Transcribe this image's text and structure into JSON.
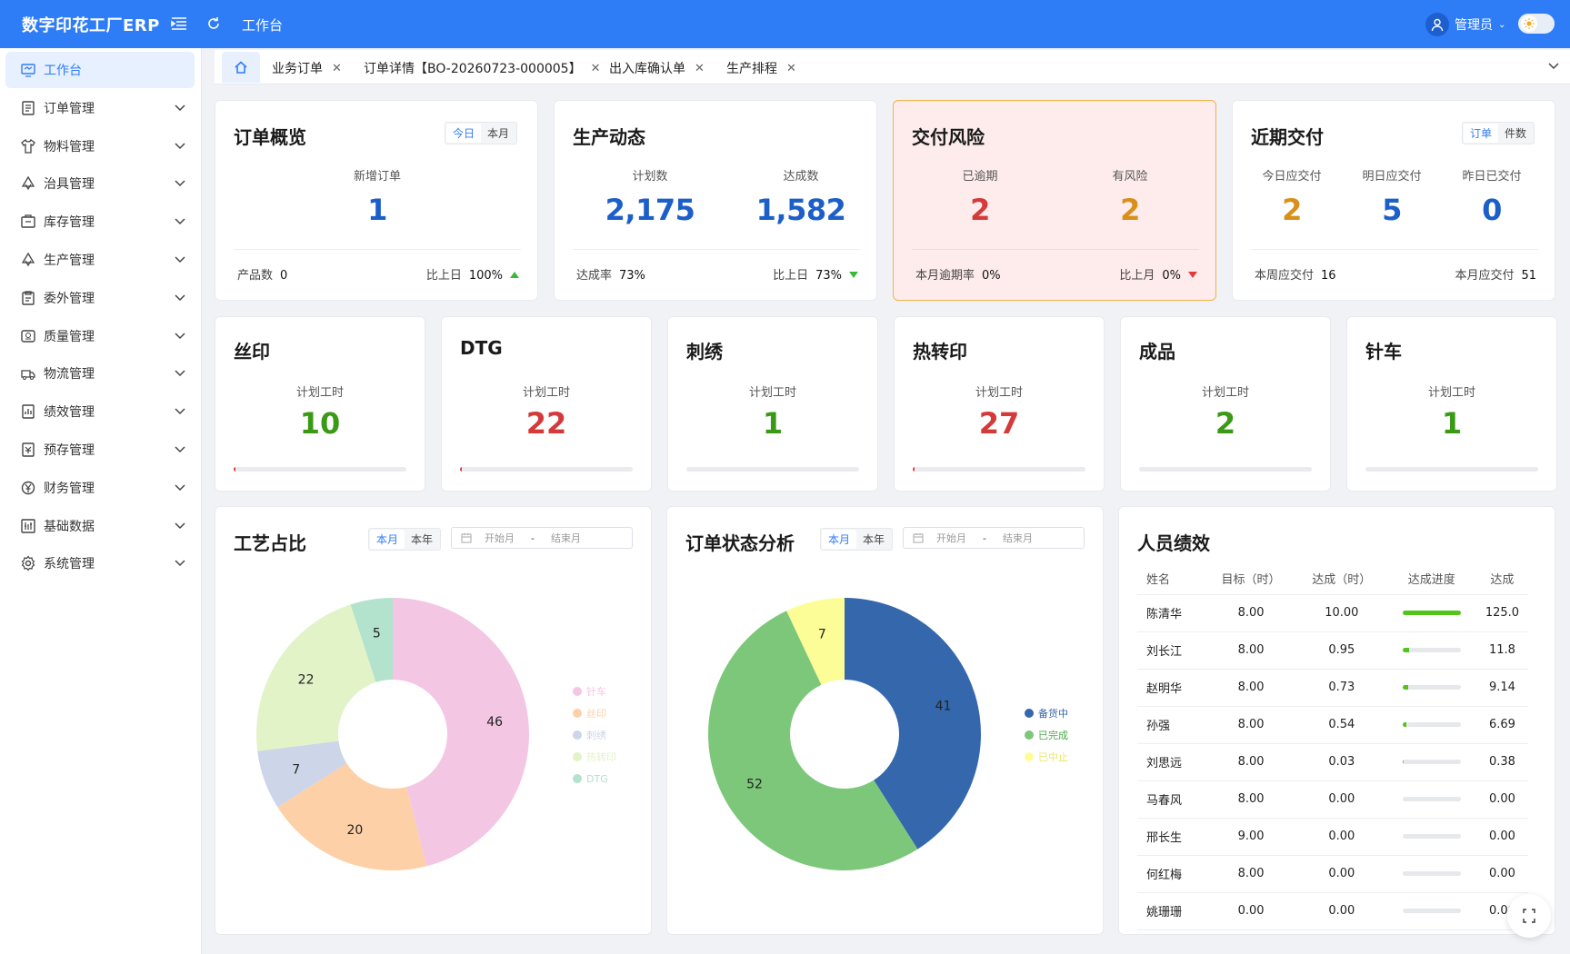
{
  "app": {
    "title": "数字印花工厂ERP",
    "breadcrumb": "工作台"
  },
  "user": {
    "name": "管理员"
  },
  "sidebar": {
    "items": [
      {
        "label": "工作台",
        "icon": "monitor-icon"
      },
      {
        "label": "订单管理",
        "icon": "list-icon"
      },
      {
        "label": "物料管理",
        "icon": "shirt-icon"
      },
      {
        "label": "治具管理",
        "icon": "tool-icon"
      },
      {
        "label": "库存管理",
        "icon": "box-icon"
      },
      {
        "label": "生产管理",
        "icon": "tool-icon"
      },
      {
        "label": "委外管理",
        "icon": "clipboard-icon"
      },
      {
        "label": "质量管理",
        "icon": "badge-icon"
      },
      {
        "label": "物流管理",
        "icon": "truck-icon"
      },
      {
        "label": "绩效管理",
        "icon": "chart-icon"
      },
      {
        "label": "预存管理",
        "icon": "wallet-icon"
      },
      {
        "label": "财务管理",
        "icon": "yen-icon"
      },
      {
        "label": "基础数据",
        "icon": "database-icon"
      },
      {
        "label": "系统管理",
        "icon": "gear-icon"
      }
    ]
  },
  "tabs": [
    {
      "label": "业务订单"
    },
    {
      "label": "订单详情【BO-20260723-000005】"
    },
    {
      "label": "出入库确认单"
    },
    {
      "label": "生产排程"
    }
  ],
  "overview": {
    "title": "订单概览",
    "seg": [
      "今日",
      "本月"
    ],
    "new_label": "新增订单",
    "new_value": "1",
    "foot_left_label": "产品数",
    "foot_left_value": "0",
    "foot_right_label": "比上日",
    "foot_right_value": "100%"
  },
  "production": {
    "title": "生产动态",
    "plan_label": "计划数",
    "plan_value": "2,175",
    "done_label": "达成数",
    "done_value": "1,582",
    "foot_left_label": "达成率",
    "foot_left_value": "73%",
    "foot_right_label": "比上日",
    "foot_right_value": "73%"
  },
  "risk": {
    "title": "交付风险",
    "overdue_label": "已逾期",
    "overdue_value": "2",
    "risk_label": "有风险",
    "risk_value": "2",
    "foot_left_label": "本月逾期率",
    "foot_left_value": "0%",
    "foot_right_label": "比上月",
    "foot_right_value": "0%"
  },
  "delivery": {
    "title": "近期交付",
    "seg": [
      "订单",
      "件数"
    ],
    "today_label": "今日应交付",
    "today_value": "2",
    "tomorrow_label": "明日应交付",
    "tomorrow_value": "5",
    "yesterday_label": "昨日已交付",
    "yesterday_value": "0",
    "foot_left_label": "本周应交付",
    "foot_left_value": "16",
    "foot_right_label": "本月应交付",
    "foot_right_value": "51"
  },
  "processes": [
    {
      "name": "丝印",
      "label": "计划工时",
      "value": "10",
      "color": "#3a9a16",
      "progress": 0.01
    },
    {
      "name": "DTG",
      "label": "计划工时",
      "value": "22",
      "color": "#d43a3a",
      "progress": 0.01
    },
    {
      "name": "刺绣",
      "label": "计划工时",
      "value": "1",
      "color": "#3a9a16",
      "progress": 0.0
    },
    {
      "name": "热转印",
      "label": "计划工时",
      "value": "27",
      "color": "#d43a3a",
      "progress": 0.01
    },
    {
      "name": "成品",
      "label": "计划工时",
      "value": "2",
      "color": "#3a9a16",
      "progress": 0.0
    },
    {
      "name": "针车",
      "label": "计划工时",
      "value": "1",
      "color": "#3a9a16",
      "progress": 0.0
    }
  ],
  "craft_chart": {
    "title": "工艺占比",
    "seg": [
      "本月",
      "本年"
    ],
    "date_start": "开始月",
    "date_end": "结束月"
  },
  "status_chart": {
    "title": "订单状态分析",
    "seg": [
      "本月",
      "本年"
    ],
    "date_start": "开始月",
    "date_end": "结束月"
  },
  "chart_data": [
    {
      "type": "pie",
      "title": "工艺占比",
      "categories": [
        "针车",
        "丝印",
        "刺绣",
        "热转印",
        "DTG"
      ],
      "values": [
        46,
        20,
        7,
        22,
        5
      ],
      "colors": [
        "#f3c6e3",
        "#fdd0a8",
        "#cdd5e8",
        "#e2f3c8",
        "#b3e2cd"
      ],
      "donut": true,
      "legend": "right"
    },
    {
      "type": "pie",
      "title": "订单状态分析",
      "categories": [
        "备货中",
        "已完成",
        "已中止"
      ],
      "values": [
        41,
        52,
        7
      ],
      "colors": [
        "#3567ac",
        "#7dc77a",
        "#fdfd98"
      ],
      "donut": true,
      "legend": "right"
    }
  ],
  "performance": {
    "title": "人员绩效",
    "columns": [
      "姓名",
      "目标（时）",
      "达成（时）",
      "达成进度",
      "达成"
    ],
    "rows": [
      {
        "name": "陈清华",
        "target": "8.00",
        "done": "10.00",
        "progress": 1.0,
        "rate": "125.0"
      },
      {
        "name": "刘长江",
        "target": "8.00",
        "done": "0.95",
        "progress": 0.12,
        "rate": "11.8"
      },
      {
        "name": "赵明华",
        "target": "8.00",
        "done": "0.73",
        "progress": 0.09,
        "rate": "9.14"
      },
      {
        "name": "孙强",
        "target": "8.00",
        "done": "0.54",
        "progress": 0.07,
        "rate": "6.69"
      },
      {
        "name": "刘思远",
        "target": "8.00",
        "done": "0.03",
        "progress": 0.01,
        "rate": "0.38"
      },
      {
        "name": "马春风",
        "target": "8.00",
        "done": "0.00",
        "progress": 0,
        "rate": "0.00"
      },
      {
        "name": "邢长生",
        "target": "9.00",
        "done": "0.00",
        "progress": 0,
        "rate": "0.00"
      },
      {
        "name": "何红梅",
        "target": "8.00",
        "done": "0.00",
        "progress": 0,
        "rate": "0.00"
      },
      {
        "name": "姚珊珊",
        "target": "0.00",
        "done": "0.00",
        "progress": 0,
        "rate": "0.00"
      }
    ]
  },
  "colors": {
    "primary": "#2f7df6",
    "blue_value": "#1d5fc9",
    "red_value": "#d43a3a",
    "orange_value": "#d9901a",
    "green_value": "#3a9a16"
  }
}
